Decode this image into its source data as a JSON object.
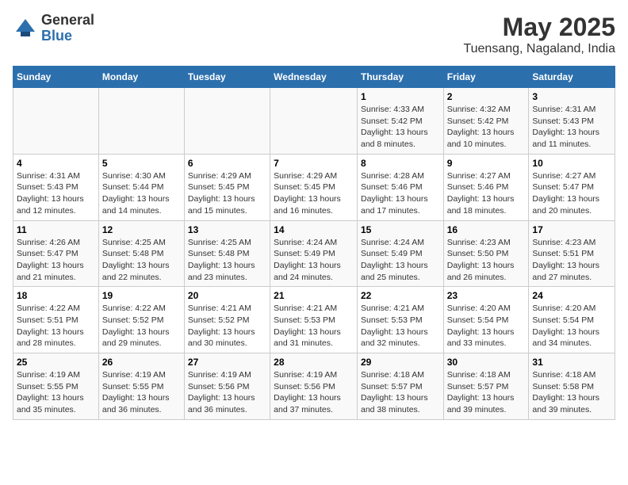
{
  "header": {
    "logo_general": "General",
    "logo_blue": "Blue",
    "month_year": "May 2025",
    "location": "Tuensang, Nagaland, India"
  },
  "days_of_week": [
    "Sunday",
    "Monday",
    "Tuesday",
    "Wednesday",
    "Thursday",
    "Friday",
    "Saturday"
  ],
  "weeks": [
    [
      {
        "day": "",
        "info": ""
      },
      {
        "day": "",
        "info": ""
      },
      {
        "day": "",
        "info": ""
      },
      {
        "day": "",
        "info": ""
      },
      {
        "day": "1",
        "info": "Sunrise: 4:33 AM\nSunset: 5:42 PM\nDaylight: 13 hours\nand 8 minutes."
      },
      {
        "day": "2",
        "info": "Sunrise: 4:32 AM\nSunset: 5:42 PM\nDaylight: 13 hours\nand 10 minutes."
      },
      {
        "day": "3",
        "info": "Sunrise: 4:31 AM\nSunset: 5:43 PM\nDaylight: 13 hours\nand 11 minutes."
      }
    ],
    [
      {
        "day": "4",
        "info": "Sunrise: 4:31 AM\nSunset: 5:43 PM\nDaylight: 13 hours\nand 12 minutes."
      },
      {
        "day": "5",
        "info": "Sunrise: 4:30 AM\nSunset: 5:44 PM\nDaylight: 13 hours\nand 14 minutes."
      },
      {
        "day": "6",
        "info": "Sunrise: 4:29 AM\nSunset: 5:45 PM\nDaylight: 13 hours\nand 15 minutes."
      },
      {
        "day": "7",
        "info": "Sunrise: 4:29 AM\nSunset: 5:45 PM\nDaylight: 13 hours\nand 16 minutes."
      },
      {
        "day": "8",
        "info": "Sunrise: 4:28 AM\nSunset: 5:46 PM\nDaylight: 13 hours\nand 17 minutes."
      },
      {
        "day": "9",
        "info": "Sunrise: 4:27 AM\nSunset: 5:46 PM\nDaylight: 13 hours\nand 18 minutes."
      },
      {
        "day": "10",
        "info": "Sunrise: 4:27 AM\nSunset: 5:47 PM\nDaylight: 13 hours\nand 20 minutes."
      }
    ],
    [
      {
        "day": "11",
        "info": "Sunrise: 4:26 AM\nSunset: 5:47 PM\nDaylight: 13 hours\nand 21 minutes."
      },
      {
        "day": "12",
        "info": "Sunrise: 4:25 AM\nSunset: 5:48 PM\nDaylight: 13 hours\nand 22 minutes."
      },
      {
        "day": "13",
        "info": "Sunrise: 4:25 AM\nSunset: 5:48 PM\nDaylight: 13 hours\nand 23 minutes."
      },
      {
        "day": "14",
        "info": "Sunrise: 4:24 AM\nSunset: 5:49 PM\nDaylight: 13 hours\nand 24 minutes."
      },
      {
        "day": "15",
        "info": "Sunrise: 4:24 AM\nSunset: 5:49 PM\nDaylight: 13 hours\nand 25 minutes."
      },
      {
        "day": "16",
        "info": "Sunrise: 4:23 AM\nSunset: 5:50 PM\nDaylight: 13 hours\nand 26 minutes."
      },
      {
        "day": "17",
        "info": "Sunrise: 4:23 AM\nSunset: 5:51 PM\nDaylight: 13 hours\nand 27 minutes."
      }
    ],
    [
      {
        "day": "18",
        "info": "Sunrise: 4:22 AM\nSunset: 5:51 PM\nDaylight: 13 hours\nand 28 minutes."
      },
      {
        "day": "19",
        "info": "Sunrise: 4:22 AM\nSunset: 5:52 PM\nDaylight: 13 hours\nand 29 minutes."
      },
      {
        "day": "20",
        "info": "Sunrise: 4:21 AM\nSunset: 5:52 PM\nDaylight: 13 hours\nand 30 minutes."
      },
      {
        "day": "21",
        "info": "Sunrise: 4:21 AM\nSunset: 5:53 PM\nDaylight: 13 hours\nand 31 minutes."
      },
      {
        "day": "22",
        "info": "Sunrise: 4:21 AM\nSunset: 5:53 PM\nDaylight: 13 hours\nand 32 minutes."
      },
      {
        "day": "23",
        "info": "Sunrise: 4:20 AM\nSunset: 5:54 PM\nDaylight: 13 hours\nand 33 minutes."
      },
      {
        "day": "24",
        "info": "Sunrise: 4:20 AM\nSunset: 5:54 PM\nDaylight: 13 hours\nand 34 minutes."
      }
    ],
    [
      {
        "day": "25",
        "info": "Sunrise: 4:19 AM\nSunset: 5:55 PM\nDaylight: 13 hours\nand 35 minutes."
      },
      {
        "day": "26",
        "info": "Sunrise: 4:19 AM\nSunset: 5:55 PM\nDaylight: 13 hours\nand 36 minutes."
      },
      {
        "day": "27",
        "info": "Sunrise: 4:19 AM\nSunset: 5:56 PM\nDaylight: 13 hours\nand 36 minutes."
      },
      {
        "day": "28",
        "info": "Sunrise: 4:19 AM\nSunset: 5:56 PM\nDaylight: 13 hours\nand 37 minutes."
      },
      {
        "day": "29",
        "info": "Sunrise: 4:18 AM\nSunset: 5:57 PM\nDaylight: 13 hours\nand 38 minutes."
      },
      {
        "day": "30",
        "info": "Sunrise: 4:18 AM\nSunset: 5:57 PM\nDaylight: 13 hours\nand 39 minutes."
      },
      {
        "day": "31",
        "info": "Sunrise: 4:18 AM\nSunset: 5:58 PM\nDaylight: 13 hours\nand 39 minutes."
      }
    ]
  ]
}
